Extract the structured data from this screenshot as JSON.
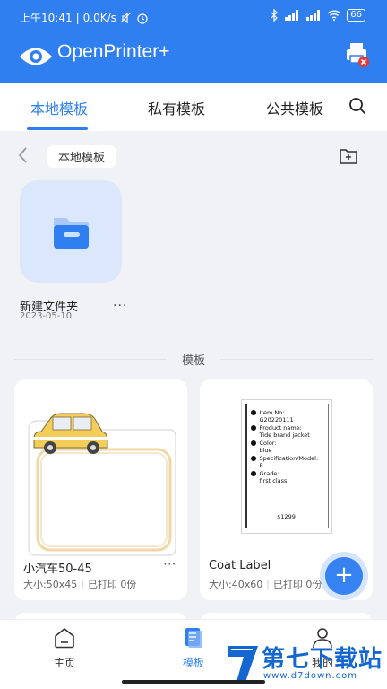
{
  "status_bar": {
    "time": "上午10:41",
    "speed": "0.0K/s",
    "battery": "66"
  },
  "app": {
    "title": "OpenPrinter+"
  },
  "tabs": [
    {
      "label": "本地模板",
      "active": true
    },
    {
      "label": "私有模板",
      "active": false
    },
    {
      "label": "公共模板",
      "active": false
    }
  ],
  "breadcrumb": {
    "current": "本地模板"
  },
  "folder": {
    "name": "新建文件夹",
    "date": "2023-05-10",
    "more": "···"
  },
  "section": {
    "label": "模板"
  },
  "templates": [
    {
      "title": "小汽车50-45",
      "size": "大小:50x45",
      "printed": "已打印 0份",
      "more": "···"
    },
    {
      "title": "Coat Label",
      "size": "大小:40x60",
      "printed": "已打印 0份",
      "label_lines": [
        "Item No:",
        "G20220111",
        "Product name:",
        "Tide brand jacket",
        "Color:",
        "blue",
        "Specification/Model:",
        "F",
        "Grade:",
        "first class",
        "$1299"
      ]
    }
  ],
  "fab": {
    "label": "+"
  },
  "bottom_nav": [
    {
      "label": "主页",
      "icon": "home-icon",
      "active": false
    },
    {
      "label": "模板",
      "icon": "template-icon",
      "active": true
    },
    {
      "label": "我的",
      "icon": "profile-icon",
      "active": false
    }
  ],
  "watermark": {
    "title": "第七下载站",
    "url": "www.d7down.com"
  },
  "colors": {
    "primary": "#2f7ff0",
    "background": "#f1f2f5",
    "folder_tile": "#dbe8fc",
    "alert": "#e53935"
  }
}
